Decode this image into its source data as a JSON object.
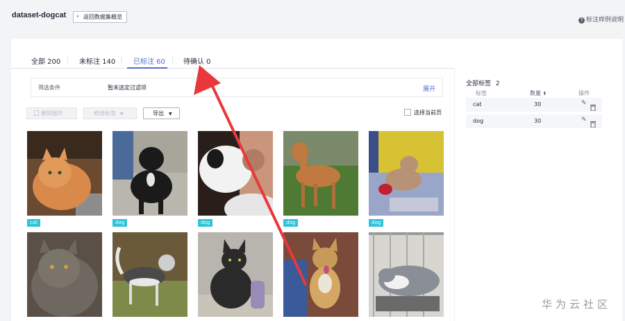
{
  "header": {
    "dataset_name": "dataset-dogcat",
    "back_label": "返回数据集概览",
    "guide_label": "标注样例说明"
  },
  "tabs": [
    {
      "label": "全部 200"
    },
    {
      "label": "未标注 140"
    },
    {
      "label": "已标注 60"
    },
    {
      "label": "待确认 0"
    }
  ],
  "filter": {
    "label": "筛选条件",
    "value": "暂未选定过滤项",
    "expand_label": "展开"
  },
  "actions": {
    "delete_label": "删除图片",
    "modify_label": "修改标签",
    "export_label": "导出",
    "select_page_label": "选择当前页"
  },
  "images": [
    {
      "tag": "cat",
      "icon": "cat-photo"
    },
    {
      "tag": "dog",
      "icon": "dog-photo"
    },
    {
      "tag": "dog",
      "icon": "dog-photo"
    },
    {
      "tag": "dog",
      "icon": "dog-photo"
    },
    {
      "tag": "dog",
      "icon": "dog-photo"
    },
    {
      "tag": "",
      "icon": "cat-photo"
    },
    {
      "tag": "",
      "icon": "dog-photo"
    },
    {
      "tag": "",
      "icon": "cat-photo"
    },
    {
      "tag": "",
      "icon": "dog-photo"
    },
    {
      "tag": "",
      "icon": "cat-photo"
    }
  ],
  "labels_panel": {
    "title": "全部标签",
    "count": "2",
    "col_label": "标签",
    "col_count": "数量",
    "col_ops": "操作",
    "rows": [
      {
        "name": "cat",
        "count": "30"
      },
      {
        "name": "dog",
        "count": "30"
      }
    ]
  },
  "watermark": "华为云社区",
  "colors": {
    "accent": "#526ecc",
    "tag_badge": "#30c3d7",
    "annotation_arrow": "#e8383c"
  }
}
